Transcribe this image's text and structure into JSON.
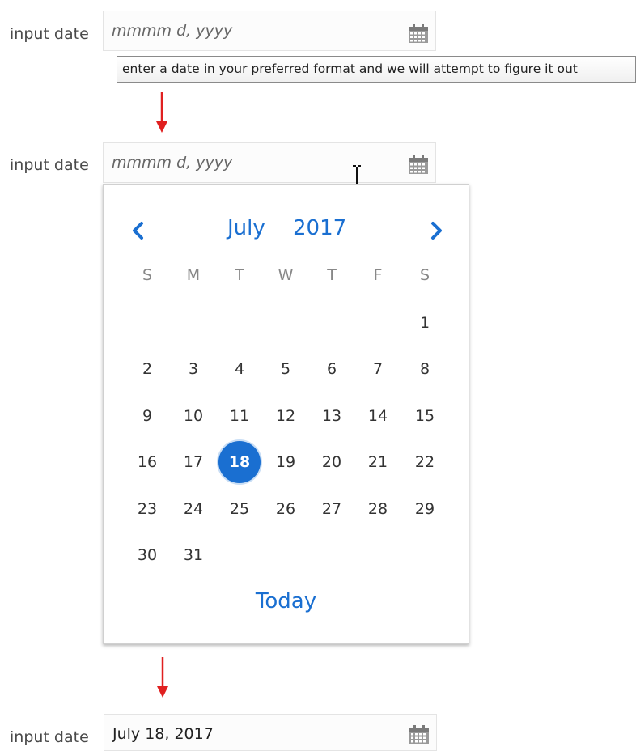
{
  "fields": {
    "label": "input date",
    "placeholder": "mmmm d, yyyy",
    "final_value": "July 18, 2017"
  },
  "tooltip": "enter a date in your preferred format and we will attempt to figure it out",
  "calendar": {
    "month": "July",
    "year": "2017",
    "weekdays": [
      "S",
      "M",
      "T",
      "W",
      "T",
      "F",
      "S"
    ],
    "weeks": [
      [
        "",
        "",
        "",
        "",
        "",
        "",
        "1"
      ],
      [
        "2",
        "3",
        "4",
        "5",
        "6",
        "7",
        "8"
      ],
      [
        "9",
        "10",
        "11",
        "12",
        "13",
        "14",
        "15"
      ],
      [
        "16",
        "17",
        "18",
        "19",
        "20",
        "21",
        "22"
      ],
      [
        "23",
        "24",
        "25",
        "26",
        "27",
        "28",
        "29"
      ],
      [
        "30",
        "31",
        "",
        "",
        "",
        "",
        ""
      ]
    ],
    "selected_day": "18",
    "today_label": "Today",
    "accent_color": "#1a6fd1"
  },
  "icons": {
    "calendar": "calendar-icon",
    "prev": "chevron-left-icon",
    "next": "chevron-right-icon",
    "arrow": "arrow-down-icon",
    "cursor": "text-cursor-icon"
  },
  "arrow_color": "#e02020"
}
